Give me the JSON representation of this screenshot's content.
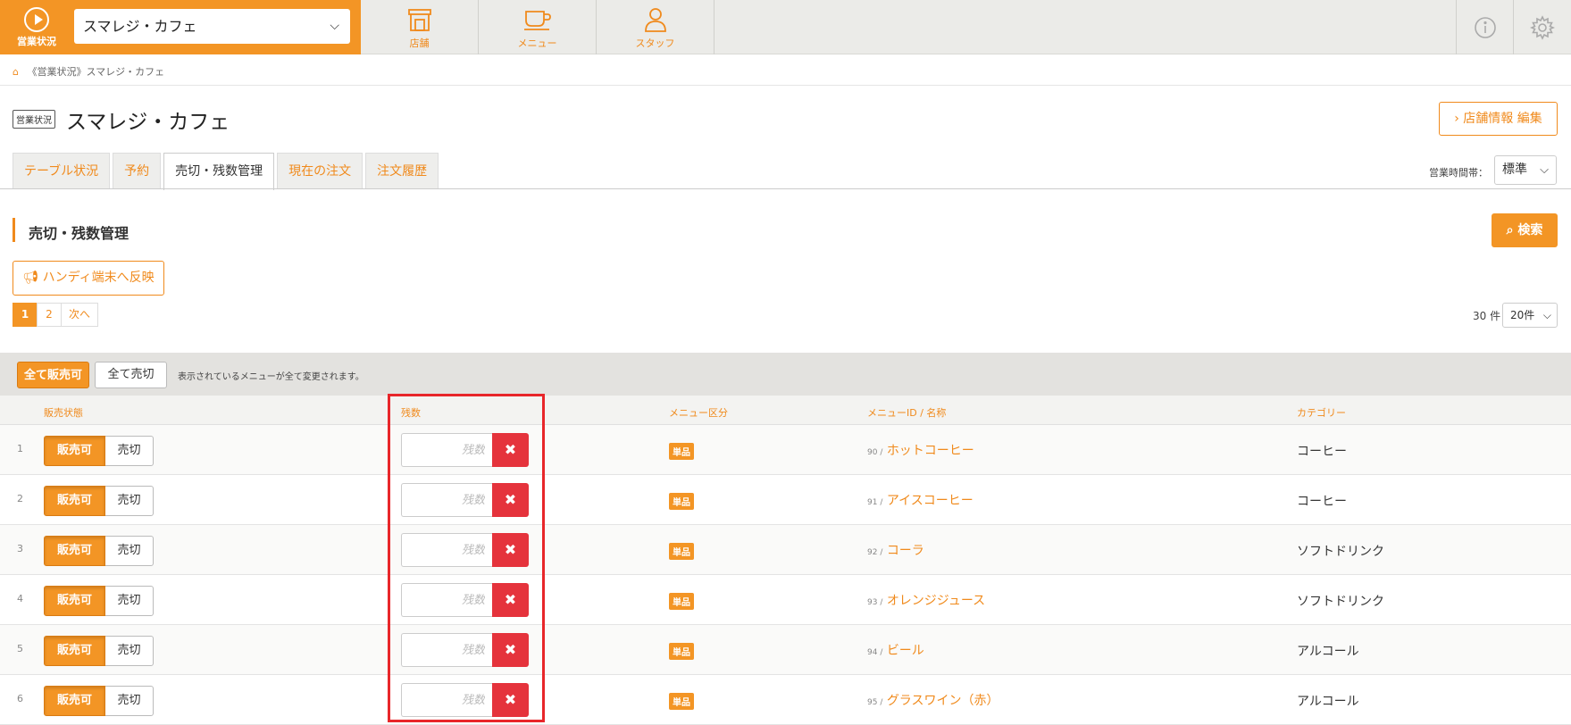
{
  "topbar": {
    "brand_label": "営業状況",
    "store_select": "スマレジ・カフェ",
    "nav": [
      {
        "label": "店舗",
        "icon": "store-icon"
      },
      {
        "label": "メニュー",
        "icon": "coffee-cup-icon"
      },
      {
        "label": "スタッフ",
        "icon": "staff-icon"
      }
    ]
  },
  "breadcrumb": "《営業状況》スマレジ・カフェ",
  "header": {
    "status_tag": "営業状況",
    "title": "スマレジ・カフェ",
    "edit_button": "店舗情報 編集"
  },
  "tabs": [
    "テーブル状況",
    "予約",
    "売切・残数管理",
    "現在の注文",
    "注文履歴"
  ],
  "active_tab": "売切・残数管理",
  "hours": {
    "label": "営業時間帯：",
    "value": "標準"
  },
  "section": {
    "title": "売切・残数管理",
    "search_button": "検索",
    "handy_button": "ハンディ端末へ反映"
  },
  "pagination": {
    "pages": [
      "1",
      "2"
    ],
    "current": "1",
    "next": "次へ",
    "total": "30 件",
    "per_page": "20件"
  },
  "bulk": {
    "all_available": "全て販売可",
    "all_sold_out": "全て売切",
    "note": "表示されているメニューが全て変更されます。"
  },
  "columns": {
    "status": "販売状態",
    "remaining": "残数",
    "menu_type": "メニュー区分",
    "menu_id_name": "メニューID / 名称",
    "category": "カテゴリー"
  },
  "row_labels": {
    "available": "販売可",
    "sold_out": "売切",
    "remaining_placeholder": "残数",
    "clear": "✖"
  },
  "rows": [
    {
      "num": "1",
      "type": "単品",
      "id": "90 /",
      "name": "ホットコーヒー",
      "category": "コーヒー"
    },
    {
      "num": "2",
      "type": "単品",
      "id": "91 /",
      "name": "アイスコーヒー",
      "category": "コーヒー"
    },
    {
      "num": "3",
      "type": "単品",
      "id": "92 /",
      "name": "コーラ",
      "category": "ソフトドリンク"
    },
    {
      "num": "4",
      "type": "単品",
      "id": "93 /",
      "name": "オレンジジュース",
      "category": "ソフトドリンク"
    },
    {
      "num": "5",
      "type": "単品",
      "id": "94 /",
      "name": "ビール",
      "category": "アルコール"
    },
    {
      "num": "6",
      "type": "単品",
      "id": "95 /",
      "name": "グラスワイン（赤）",
      "category": "アルコール"
    }
  ],
  "colors": {
    "accent": "#f39525",
    "danger": "#e5333c",
    "highlight": "#e8262a"
  }
}
